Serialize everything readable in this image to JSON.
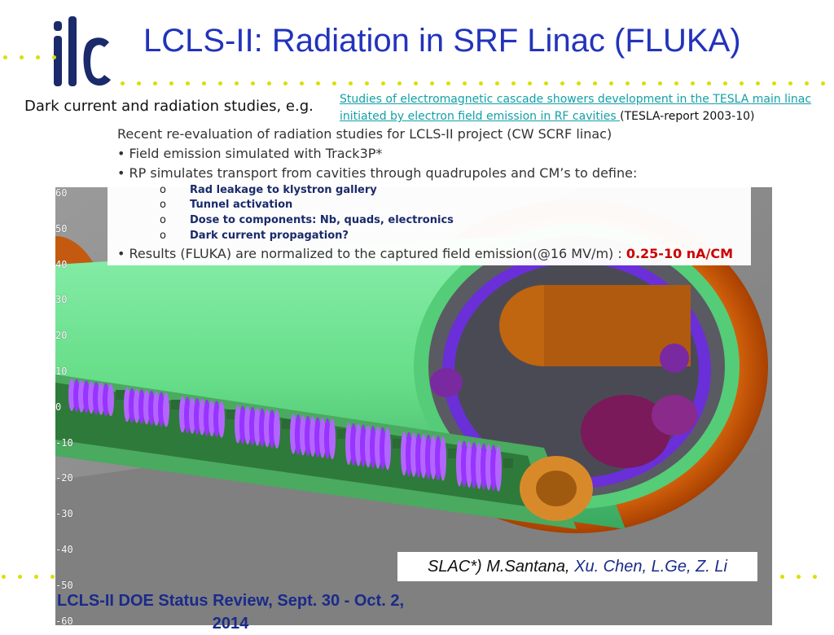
{
  "logo_text": "ilc",
  "title": "LCLS-II: Radiation in SRF Linac (FLUKA)",
  "lead_text": "Dark current and radiation studies, e.g.",
  "reference": {
    "link_text": "Studies of electromagnetic cascade showers development in the TESLA main linac initiated by electron field emission in RF cavities ",
    "suffix": "(TESLA-report 2003-10)"
  },
  "intro": "Recent re-evaluation of radiation studies for LCLS-II project (CW SCRF linac)",
  "bullets": [
    "Field emission simulated with Track3P*",
    "RP simulates transport from cavities through quadrupoles and CM’s to define:"
  ],
  "sub_marker": "o",
  "sub_items": [
    "Rad leakage to klystron gallery",
    "Tunnel activation",
    "Dose to components: Nb, quads, electronics",
    "Dark current propagation?"
  ],
  "results": {
    "text": "Results (FLUKA) are normalized to the captured field emission(@16 MV/m) : ",
    "highlight": "0.25-10 nA/CM"
  },
  "bullet_char": "•",
  "axis_ticks": [
    "60",
    "50",
    "40",
    "30",
    "20",
    "10",
    "0",
    "-10",
    "-20",
    "-30",
    "-40",
    "-50",
    "-60"
  ],
  "credit": {
    "prefix": "SLAC*) M.Santana, ",
    "names": "Xu. Chen, L.Ge, Z. Li"
  },
  "footer": "LCLS-II DOE Status Review, Sept. 30 - Oct. 2, 2014",
  "colors": {
    "title_blue": "#2233bb",
    "link_teal": "#12a0a8",
    "highlight_red": "#cc0000",
    "dots_yellow": "#d8e000",
    "cryomodule_green": "#66dd88",
    "cavity_purple": "#9933ff",
    "shield_orange": "#cc5500"
  }
}
